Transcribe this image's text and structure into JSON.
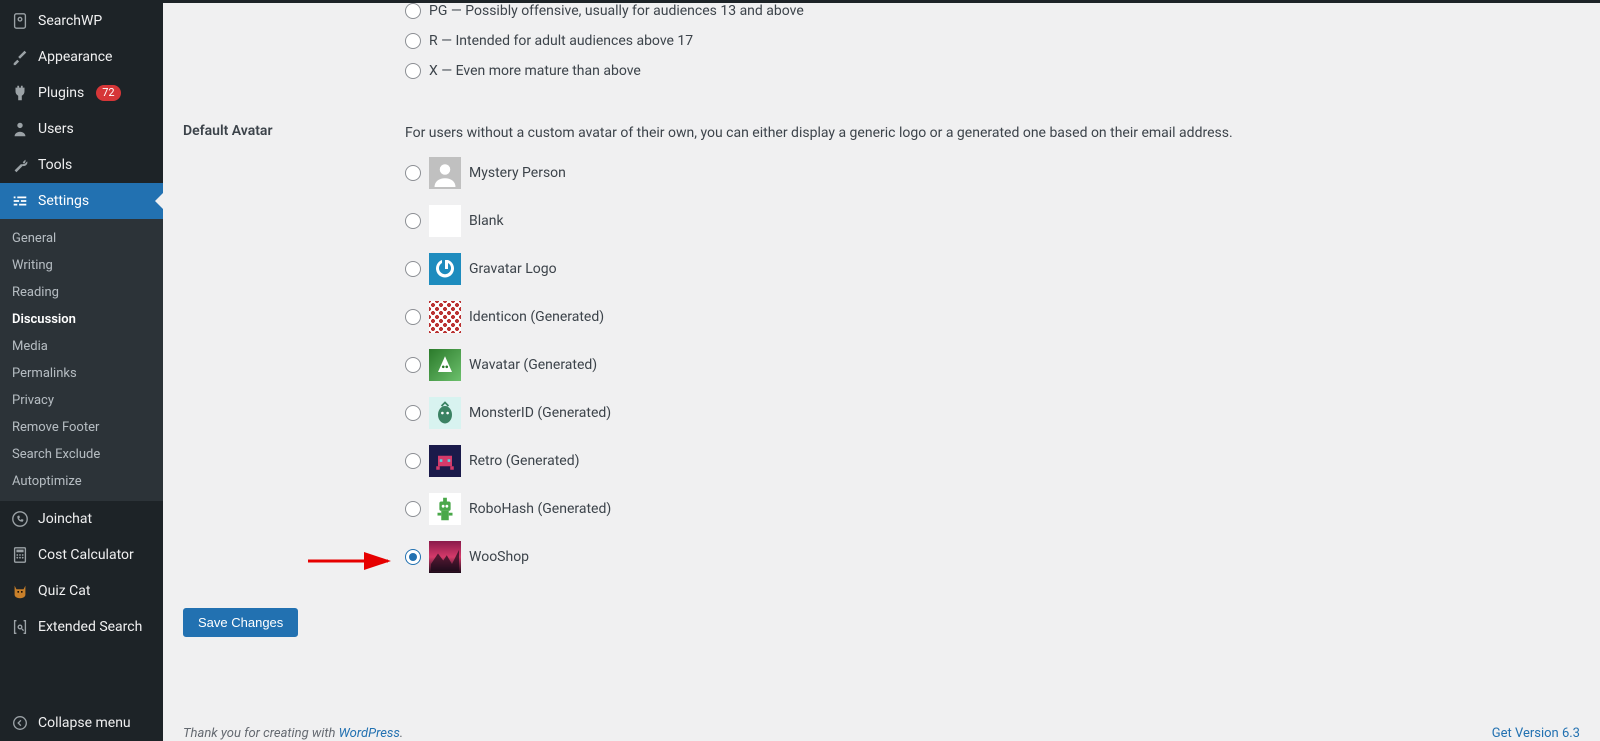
{
  "sidebar": {
    "items": [
      {
        "label": "SearchWP",
        "icon": "searchwp"
      },
      {
        "label": "Appearance",
        "icon": "brush"
      },
      {
        "label": "Plugins",
        "icon": "plug",
        "badge": "72"
      },
      {
        "label": "Users",
        "icon": "user"
      },
      {
        "label": "Tools",
        "icon": "wrench"
      },
      {
        "label": "Settings",
        "icon": "sliders",
        "current": true
      },
      {
        "label": "Joinchat",
        "icon": "whatsapp"
      },
      {
        "label": "Cost Calculator",
        "icon": "calculator"
      },
      {
        "label": "Quiz Cat",
        "icon": "cat"
      },
      {
        "label": "Extended Search",
        "icon": "brackets"
      }
    ],
    "settings_submenu": [
      {
        "label": "General"
      },
      {
        "label": "Writing"
      },
      {
        "label": "Reading"
      },
      {
        "label": "Discussion",
        "active": true
      },
      {
        "label": "Media"
      },
      {
        "label": "Permalinks"
      },
      {
        "label": "Privacy"
      },
      {
        "label": "Remove Footer"
      },
      {
        "label": "Search Exclude"
      },
      {
        "label": "Autoptimize"
      }
    ],
    "collapse_label": "Collapse menu"
  },
  "ratings": {
    "pg": "PG — Possibly offensive, usually for audiences 13 and above",
    "r": "R — Intended for adult audiences above 17",
    "x": "X — Even more mature than above"
  },
  "default_avatar": {
    "section_label": "Default Avatar",
    "description": "For users without a custom avatar of their own, you can either display a generic logo or a generated one based on their email address.",
    "options": {
      "mystery": "Mystery Person",
      "blank": "Blank",
      "gravatar": "Gravatar Logo",
      "identicon": "Identicon (Generated)",
      "wavatar": "Wavatar (Generated)",
      "monsterid": "MonsterID (Generated)",
      "retro": "Retro (Generated)",
      "robohash": "RoboHash (Generated)",
      "wooshop": "WooShop"
    }
  },
  "save_button_label": "Save Changes",
  "footer": {
    "thank_you": "Thank you for creating with ",
    "wordpress": "WordPress",
    "version_link": "Get Version 6.3"
  }
}
